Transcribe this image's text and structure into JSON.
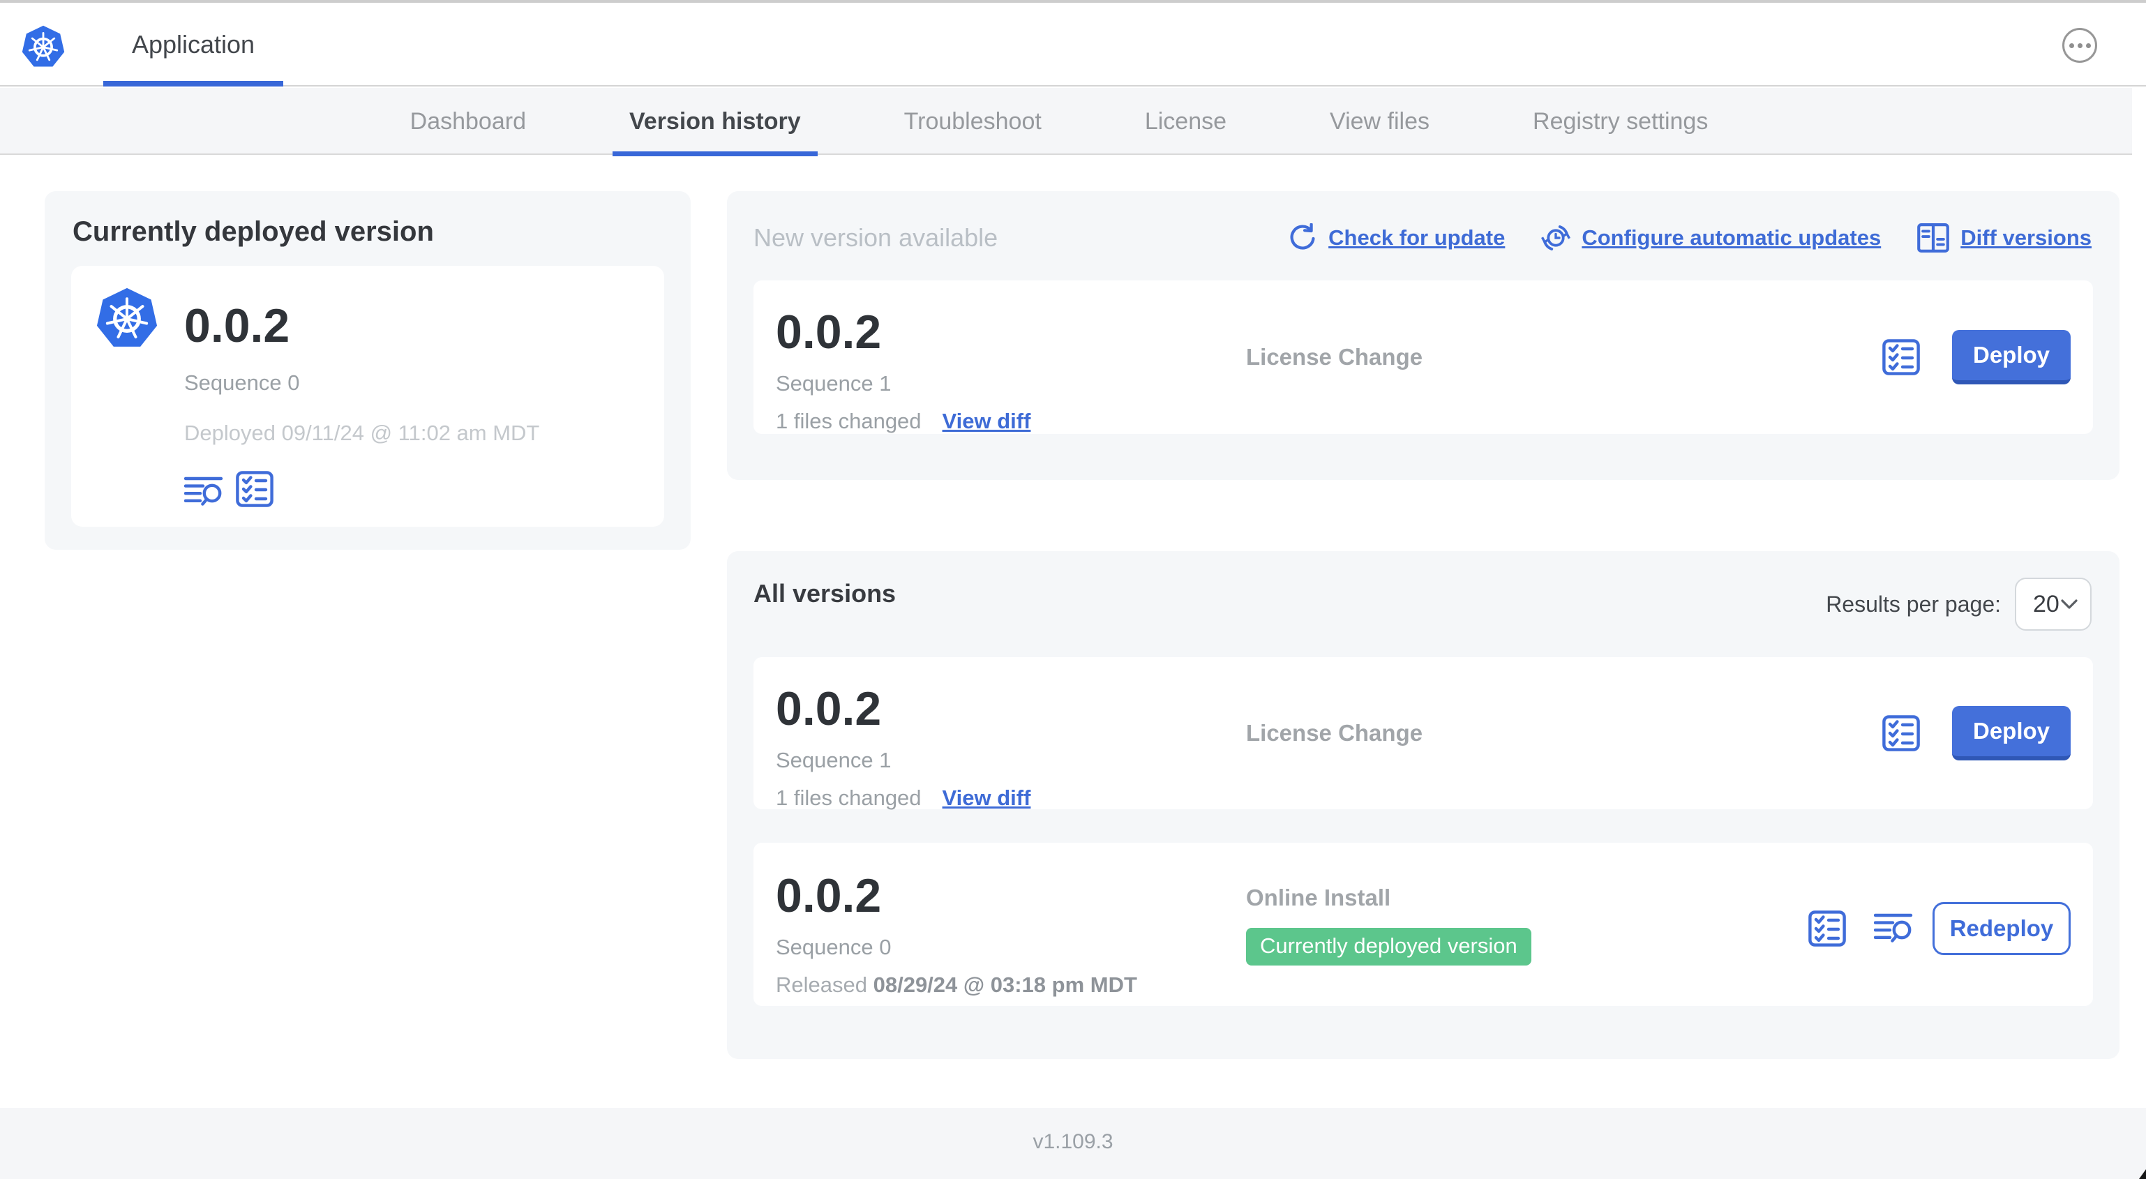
{
  "colors": {
    "accent_blue": "#3e6bd6",
    "button_blue": "#4470da",
    "k8s_blue": "#326de6",
    "badge_green": "#5cc68c",
    "card_gray": "#f5f7f9"
  },
  "header": {
    "app_tab": "Application"
  },
  "nav": {
    "tabs": [
      "Dashboard",
      "Version history",
      "Troubleshoot",
      "License",
      "View files",
      "Registry settings"
    ],
    "active_tab": "Version history"
  },
  "current_deployed": {
    "title": "Currently deployed version",
    "version": "0.0.2",
    "sequence": "Sequence 0",
    "deployed": "Deployed 09/11/24 @ 11:02 am MDT"
  },
  "new_version": {
    "title": "New version available",
    "links": [
      {
        "label": "Check for update",
        "icon": "refresh-icon"
      },
      {
        "label": "Configure automatic updates",
        "icon": "clock-arrows-icon"
      },
      {
        "label": "Diff versions",
        "icon": "diff-icon"
      }
    ],
    "row": {
      "version": "0.0.2",
      "sequence": "Sequence 1",
      "files_changed": "1 files changed",
      "view_diff": "View diff",
      "type": "License Change",
      "action": "Deploy"
    }
  },
  "all_versions": {
    "title": "All versions",
    "results_per_page_label": "Results per page:",
    "results_per_page_value": "20",
    "rows": [
      {
        "version": "0.0.2",
        "sequence": "Sequence 1",
        "files_changed": "1 files changed",
        "view_diff": "View diff",
        "type": "License Change",
        "action": "Deploy"
      },
      {
        "version": "0.0.2",
        "sequence": "Sequence 0",
        "released_prefix": "Released",
        "released_date": "08/29/24 @ 03:18 pm MDT",
        "type": "Online Install",
        "badge": "Currently deployed version",
        "action": "Redeploy"
      }
    ]
  },
  "footer": {
    "version": "v1.109.3"
  }
}
